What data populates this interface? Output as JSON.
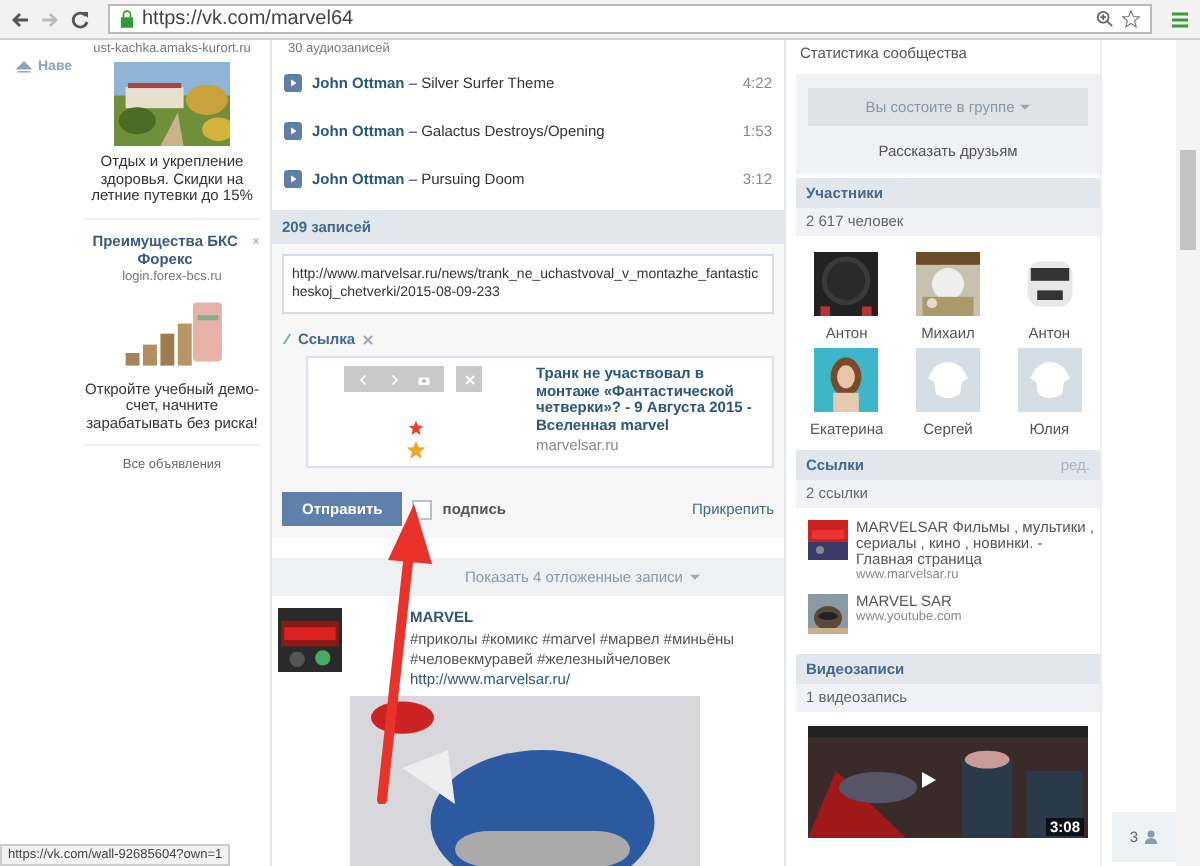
{
  "browser": {
    "url": "https://vk.com/marvel64",
    "status_url": "https://vk.com/wall-92685604?own=1"
  },
  "left_nav": {
    "to_top": "Наве"
  },
  "ads": [
    {
      "domain": "ust-kachka.amaks-kurort.ru",
      "text": "Отдых и укрепление здоровья. Скидки на летние путевки до 15%"
    },
    {
      "title": "Преимущества БКС Форекс",
      "domain": "login.forex-bcs.ru",
      "text": "Откройте учебный демо-счет, начните зарабатывать без риска!"
    }
  ],
  "ads_link": "Все объявления",
  "audio": {
    "count": "30 аудиозаписей",
    "tracks": [
      {
        "artist": "John Ottman",
        "title": "– Silver Surfer Theme",
        "duration": "4:22"
      },
      {
        "artist": "John Ottman",
        "title": "– Galactus Destroys/Opening",
        "duration": "1:53"
      },
      {
        "artist": "John Ottman",
        "title": "– Pursuing Doom",
        "duration": "3:12"
      }
    ]
  },
  "wall": {
    "header": "209 записей",
    "input": "http://www.marvelsar.ru/news/trank_ne_uchastvoval_v_montazhe_fantasticheskoj_chetverki/2015-08-09-233",
    "attachment": {
      "label": "Ссылка",
      "title": "Транк не участвовал в монтаже «Фантастической четверки»? - 9 Августа 2015 - Вселенная marvel",
      "domain": "marvelsar.ru"
    },
    "send": "Отправить",
    "signature": {
      "label": "подпись",
      "checked": false
    },
    "attach": "Прикрепить",
    "postponed": "Показать 4 отложенные записи"
  },
  "post": {
    "author": "MARVEL",
    "text": "#приколы #комикс #marvel #марвел #миньёны #человекмуравей #железныйчеловек",
    "link": "http://www.marvelsar.ru/"
  },
  "right": {
    "stats": "Статистика сообщества",
    "member_button": "Вы состоите в группе",
    "share": "Рассказать друзьям",
    "members": {
      "title": "Участники",
      "count": "2 617 человек",
      "list": [
        {
          "name": "Антон"
        },
        {
          "name": "Михаил"
        },
        {
          "name": "Антон"
        },
        {
          "name": "Екатерина"
        },
        {
          "name": "Сергей",
          "kind": "default"
        },
        {
          "name": "Юлия",
          "kind": "default"
        }
      ]
    },
    "links": {
      "title": "Ссылки",
      "edit": "ред.",
      "count": "2 ссылки",
      "list": [
        {
          "title": "MARVELSAR Фильмы , мультики , сериалы , кино , новинки. - Главная страница",
          "url": "www.marvelsar.ru"
        },
        {
          "title": "MARVEL SAR",
          "url": "www.youtube.com"
        }
      ]
    },
    "videos": {
      "title": "Видеозаписи",
      "count": "1 видеозапись",
      "duration": "3:08"
    }
  },
  "side_counter": "3"
}
